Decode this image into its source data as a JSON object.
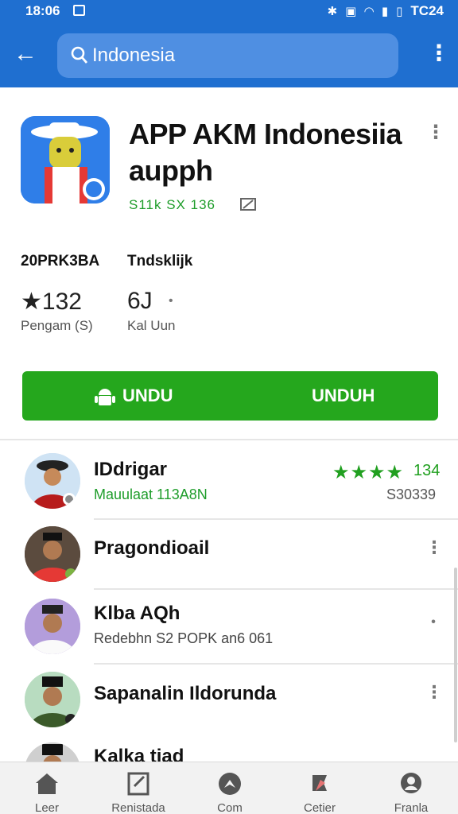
{
  "status_bar": {
    "time": "18:06",
    "battery_text": "TC24"
  },
  "search": {
    "query": "Indonesia"
  },
  "app": {
    "title": "APP AKM Indonesiia aupph",
    "meta": "S11k SX 136",
    "stat_head_1": "20PRK3BA",
    "stat_head_2": "Tndsklijk",
    "rating": "★132",
    "rating_label": "Pengam (S)",
    "size": "6J",
    "size_dot": "•",
    "size_label": "Kal Uun",
    "install_left": "UNDU",
    "install_right": "UNDUH",
    "accent_color": "#25a71d",
    "bar_color": "#1f6fd0"
  },
  "list": [
    {
      "name": "IDdrigar",
      "sub": "Mauulaat 113A8N",
      "sub_color": "#1f9d2b",
      "stars": "★★★★",
      "stars_count": "134",
      "right_sub": "S30339"
    },
    {
      "name": "Pragondioail",
      "sub": ""
    },
    {
      "name": "Klba AQh",
      "sub": "Redebhn S2 POPK an6 061",
      "sub_color": "#444"
    },
    {
      "name": "Sapanalin Ildorunda",
      "sub": ""
    },
    {
      "name": "Kalka tiad",
      "sub": ""
    }
  ],
  "nav": [
    {
      "label": "Leer",
      "icon": "home-icon"
    },
    {
      "label": "Renistada",
      "icon": "edit-box-icon"
    },
    {
      "label": "Com",
      "icon": "compass-icon"
    },
    {
      "label": "Cetier",
      "icon": "pin-icon"
    },
    {
      "label": "Franla",
      "icon": "profile-icon"
    }
  ]
}
